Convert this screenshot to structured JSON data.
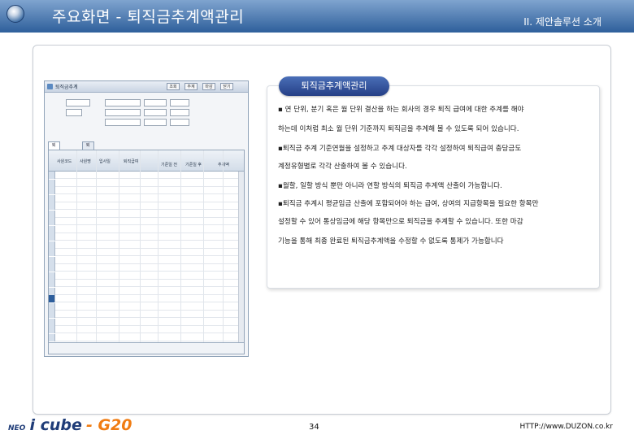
{
  "header": {
    "title": "주요화면 - 퇴직금추계액관리",
    "section": "II. 제안솔루션 소개"
  },
  "app": {
    "window_title": "퇴직금추계",
    "toolbar_buttons": [
      "조회",
      "추계",
      "마감",
      "닫기"
    ],
    "tabs": [
      "퇴직금추계",
      "퇴직금추계현황"
    ],
    "grid_headers": [
      "사원코드",
      "사원명",
      "입사일",
      "퇴직급여",
      "기준일 전",
      "기준일 후",
      "추계액"
    ]
  },
  "desc": {
    "title": "퇴직금추계액관리",
    "lines": [
      "▪ 연 단위, 분기 혹은 월 단위 결산을 하는 회사의 경우 퇴직 급여에 대한 추계를 해야",
      "하는데 이처럼 최소 월 단위 기준까지 퇴직금을 추계해 볼 수 있도록 되어 있습니다.",
      "▪퇴직금 추계 기준연월을 설정하고 추계 대상자를 각각 설정하여 퇴직급여 충당금도",
      "계정유형별로 각각 산출하여 볼 수 있습니다.",
      "▪월할, 일할 방식 뿐만 아니라 연할 방식의 퇴직금 추계액 산출이 가능합니다.",
      "▪퇴직금 추계시 평균임금 산출에 포함되어야 하는 급여, 상여의 지급항목을 필요한 항목만",
      "설정할 수 있어 통상임금에 해당 항목만으로 퇴직금을 추계할 수 있습니다. 또한 마감",
      "기능을 통해 최종 완료된 퇴직금추계액을 수정할 수 없도록 통제가 가능합니다"
    ]
  },
  "footer": {
    "logo_neo": "NEO",
    "logo_icube": "i cube",
    "logo_g20": "- G20",
    "page": "34",
    "url": "HTTP://www.DUZON.co.kr"
  },
  "colors": {
    "topbar": "#2e5f9b",
    "pill": "#253f86",
    "accent_orange": "#f07c12"
  }
}
